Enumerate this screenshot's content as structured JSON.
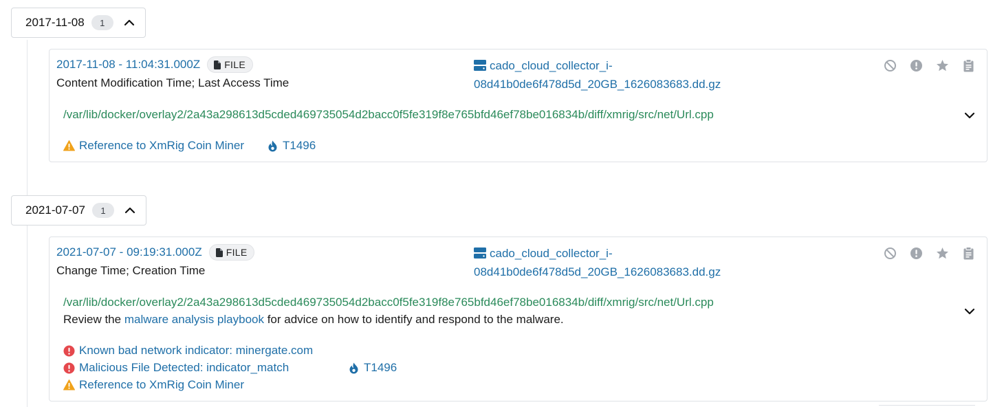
{
  "groups": [
    {
      "date": "2017-11-08",
      "count": "1",
      "event": {
        "timestamp": "2017-11-08 - 11:04:31.000Z",
        "badge": "FILE",
        "description": "Content Modification Time; Last Access Time",
        "source_line1": "cado_cloud_collector_i-",
        "source_line2": "08d41b0de6f478d5d_20GB_1626083683.dd.gz",
        "path": "/var/lib/docker/overlay2/2a43a298613d5cded469735054d2bacc0f5fe319f8e765bfd46ef78be016834b/diff/xmrig/src/net/Url.cpp",
        "alerts": [
          {
            "severity": "warning",
            "label": "Reference to XmRig Coin Miner"
          }
        ],
        "technique": "T1496"
      }
    },
    {
      "date": "2021-07-07",
      "count": "1",
      "event": {
        "timestamp": "2021-07-07 - 09:19:31.000Z",
        "badge": "FILE",
        "description": "Change Time; Creation Time",
        "source_line1": "cado_cloud_collector_i-",
        "source_line2": "08d41b0de6f478d5d_20GB_1626083683.dd.gz",
        "path": "/var/lib/docker/overlay2/2a43a298613d5cded469735054d2bacc0f5fe319f8e765bfd46ef78be016834b/diff/xmrig/src/net/Url.cpp",
        "playbook_prefix": "Review the ",
        "playbook_link": "malware analysis playbook",
        "playbook_suffix": " for advice on how to identify and respond to the malware.",
        "alerts": [
          {
            "severity": "critical",
            "label": "Known bad network indicator: minergate.com"
          },
          {
            "severity": "critical",
            "label": "Malicious File Detected: indicator_match"
          },
          {
            "severity": "warning",
            "label": "Reference to XmRig Coin Miner"
          }
        ],
        "technique": "T1496"
      }
    }
  ],
  "colors": {
    "link": "#1f6fa8",
    "path": "#2a8a5a",
    "warning": "#f0a21b",
    "critical": "#e5484d",
    "icon_gray": "#a2a7ae"
  },
  "icons": {
    "file": "file-icon",
    "drive": "hard-drive-icon",
    "ignore": "ban-icon",
    "flag": "exclamation-circle-icon",
    "star": "star-icon",
    "notes": "clipboard-icon",
    "expand": "chevron-down-icon",
    "collapse": "chevron-up-icon",
    "technique": "fire-icon"
  }
}
